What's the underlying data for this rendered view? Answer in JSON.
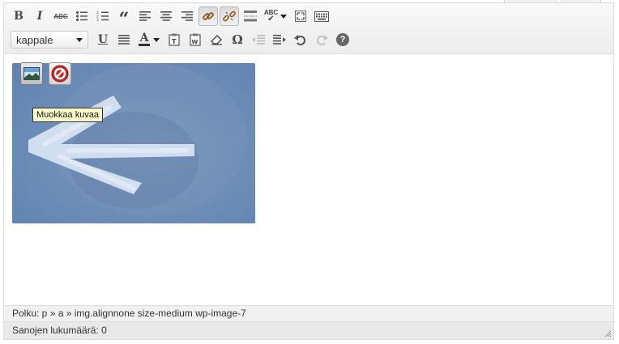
{
  "toolbar": {
    "format_select": {
      "selected": "kappale"
    },
    "row1": [
      {
        "name": "bold",
        "glyph": "B"
      },
      {
        "name": "italic",
        "glyph": "I"
      },
      {
        "name": "strikethrough",
        "glyph": "ABC"
      },
      {
        "name": "bullet-list"
      },
      {
        "name": "numbered-list"
      },
      {
        "name": "blockquote",
        "glyph": "“"
      },
      {
        "name": "align-left"
      },
      {
        "name": "align-center"
      },
      {
        "name": "align-right"
      },
      {
        "name": "insert-link",
        "active": true
      },
      {
        "name": "unlink",
        "active": true
      },
      {
        "name": "insert-more"
      },
      {
        "name": "spellcheck",
        "glyph": "ABC"
      },
      {
        "name": "fullscreen"
      },
      {
        "name": "toggle-toolbar"
      }
    ],
    "row2": [
      {
        "name": "underline",
        "glyph": "U"
      },
      {
        "name": "justify"
      },
      {
        "name": "text-color",
        "glyph": "A"
      },
      {
        "name": "paste-as-text"
      },
      {
        "name": "paste-from-word"
      },
      {
        "name": "clear-formatting"
      },
      {
        "name": "special-character",
        "glyph": "Ω"
      },
      {
        "name": "outdent"
      },
      {
        "name": "indent"
      },
      {
        "name": "undo"
      },
      {
        "name": "redo"
      },
      {
        "name": "help",
        "glyph": "?"
      }
    ]
  },
  "image_tools": {
    "edit_tooltip": "Muokkaa kuvaa"
  },
  "path_bar": {
    "text": "Polku: p » a » img.alignnone size-medium wp-image-7"
  },
  "status_bar": {
    "word_count": "Sanojen lukumäärä: 0"
  },
  "colors": {
    "toolbar_bg": "#f1f1f1",
    "image_blue": "#6f8fb8",
    "tooltip_bg": "#ffffcc",
    "delete_red": "#d42424"
  }
}
